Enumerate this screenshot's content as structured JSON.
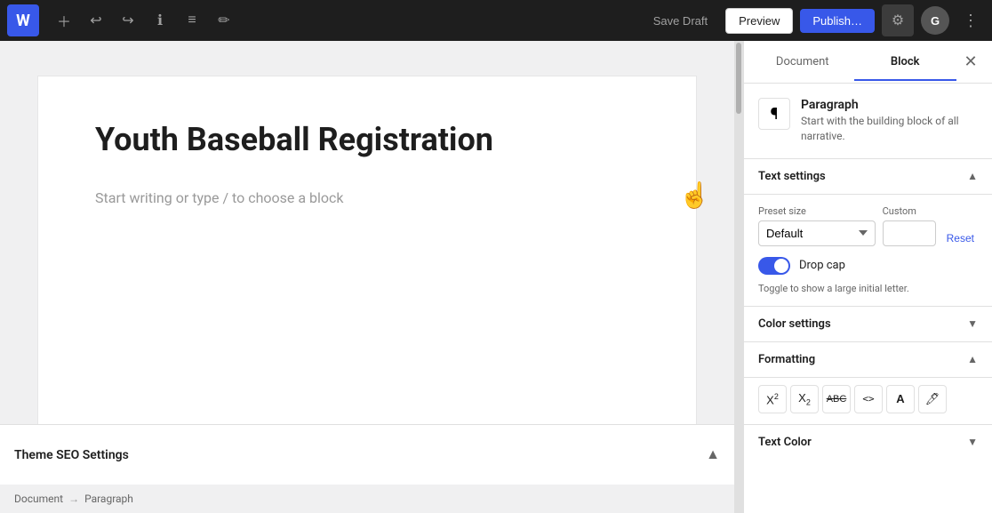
{
  "toolbar": {
    "wp_logo": "W",
    "save_draft_label": "Save Draft",
    "preview_label": "Preview",
    "publish_label": "Publish…",
    "user_initial": "G"
  },
  "editor": {
    "page_title": "Youth Baseball Registration",
    "block_placeholder": "Start writing or type / to choose a block"
  },
  "bottom_bar": {
    "theme_seo_label": "Theme SEO Settings"
  },
  "breadcrumb": {
    "document_label": "Document",
    "separator": "→",
    "paragraph_label": "Paragraph"
  },
  "panel": {
    "document_tab": "Document",
    "block_tab": "Block",
    "active_tab": "block",
    "block_info": {
      "title": "Paragraph",
      "description": "Start with the building block of all narrative."
    },
    "text_settings": {
      "section_label": "Text settings",
      "preset_size_label": "Preset size",
      "custom_label": "Custom",
      "reset_label": "Reset",
      "preset_options": [
        "Default"
      ],
      "preset_selected": "Default",
      "drop_cap_label": "Drop cap",
      "drop_cap_desc": "Toggle to show a large initial letter.",
      "drop_cap_enabled": true
    },
    "color_settings": {
      "section_label": "Color settings"
    },
    "formatting": {
      "section_label": "Formatting",
      "buttons": [
        {
          "id": "superscript",
          "label": "X²",
          "title": "Superscript"
        },
        {
          "id": "subscript",
          "label": "X₂",
          "title": "Subscript"
        },
        {
          "id": "strikethrough",
          "label": "ABC",
          "title": "Strikethrough"
        },
        {
          "id": "code",
          "label": "<>",
          "title": "Inline code"
        },
        {
          "id": "text-color",
          "label": "A",
          "title": "Text color"
        },
        {
          "id": "highlight",
          "label": "◻",
          "title": "Highlight"
        }
      ]
    },
    "text_color": {
      "section_label": "Text Color"
    }
  }
}
